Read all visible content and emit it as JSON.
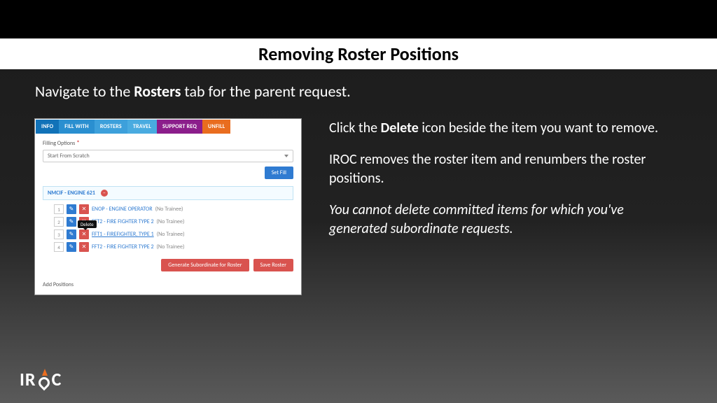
{
  "title": "Removing Roster Positions",
  "lead_pre": "Navigate to the ",
  "lead_bold": "Rosters",
  "lead_post": " tab for the parent request.",
  "shot": {
    "tabs": {
      "info": "INFO",
      "fill": "FILL WITH",
      "rosters": "ROSTERS",
      "travel": "TRAVEL",
      "support": "SUPPORT REQ",
      "unfill": "UNFILL"
    },
    "filling_label": "Filling Options",
    "select_value": "Start From Scratch",
    "set_fill": "Set Fill",
    "section_title": "NMCIF - ENGINE 621",
    "tooltip": "Delete",
    "rows": [
      {
        "num": "1",
        "code": "ENOP - ENGINE OPERATOR",
        "suffix": "(No Trainee)",
        "under": false
      },
      {
        "num": "2",
        "code": "FFT2 - FIRE FIGHTER TYPE 2",
        "suffix": "(No Trainee)",
        "under": false
      },
      {
        "num": "3",
        "code": "FFT1 - FIREFIGHTER, TYPE 1",
        "suffix": "(No Trainee)",
        "under": true
      },
      {
        "num": "4",
        "code": "FFT2 - FIRE FIGHTER TYPE 2",
        "suffix": "(No Trainee)",
        "under": false
      }
    ],
    "gen_sub": "Generate Subordinate for Roster",
    "save": "Save Roster",
    "add_positions": "Add Positions"
  },
  "explain": {
    "p1_pre": "Click the ",
    "p1_bold": "Delete",
    "p1_post": " icon beside the item you want to remove.",
    "p2": "IROC removes the roster item and renumbers the roster positions.",
    "p3": "You cannot delete committed items for which you've generated subordinate requests."
  },
  "logo": {
    "a": "IR",
    "b": "C"
  }
}
